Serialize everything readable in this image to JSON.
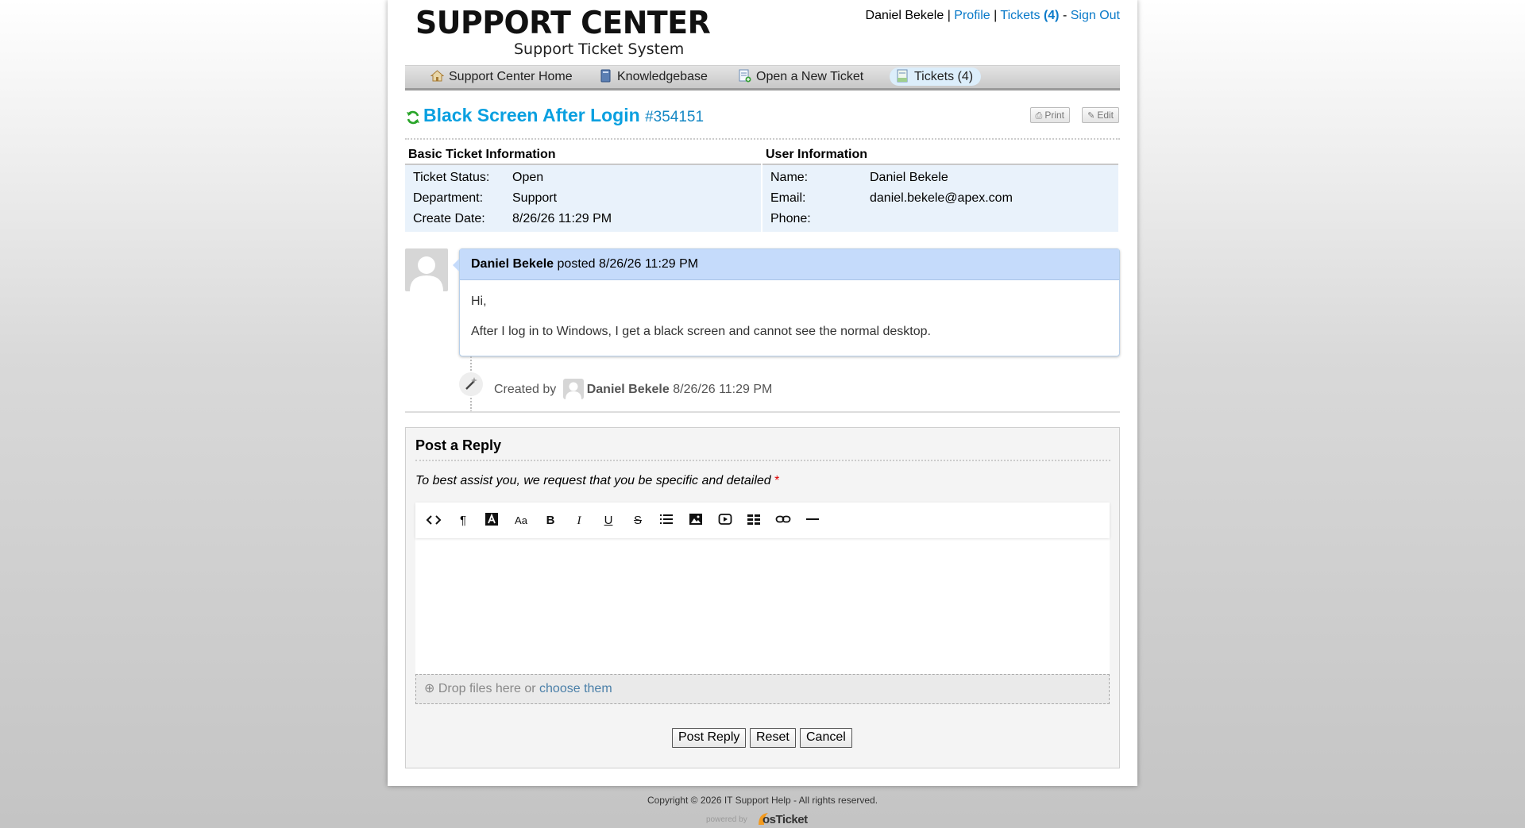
{
  "header": {
    "logo_main": "SUPPORT CENTER",
    "logo_sub": "Support Ticket System",
    "user_name": "Daniel Bekele",
    "profile_link": "Profile",
    "tickets_link": "Tickets",
    "tickets_count": "(4)",
    "signout_link": "Sign Out"
  },
  "nav": {
    "items": [
      {
        "label": "Support Center Home",
        "icon": "home-icon"
      },
      {
        "label": "Knowledgebase",
        "icon": "book-icon"
      },
      {
        "label": "Open a New Ticket",
        "icon": "new-ticket-icon"
      },
      {
        "label": "Tickets (4)",
        "icon": "tickets-icon"
      }
    ]
  },
  "ticket": {
    "title": "Black Screen After Login",
    "number": "#354151",
    "print_label": "Print",
    "edit_label": "Edit"
  },
  "basic_info": {
    "heading": "Basic Ticket Information",
    "rows": [
      {
        "label": "Ticket Status:",
        "value": "Open"
      },
      {
        "label": "Department:",
        "value": "Support"
      },
      {
        "label": "Create Date:",
        "value": "8/26/26 11:29 PM"
      }
    ]
  },
  "user_info": {
    "heading": "User Information",
    "rows": [
      {
        "label": "Name:",
        "value": "Daniel Bekele"
      },
      {
        "label": "Email:",
        "value": "daniel.bekele@apex.com"
      },
      {
        "label": "Phone:",
        "value": ""
      }
    ]
  },
  "thread": {
    "author": "Daniel Bekele",
    "posted_text": "posted 8/26/26 11:29 PM",
    "body": [
      "Hi,",
      "After I log in to Windows, I get a black screen and cannot see the normal desktop."
    ],
    "event_prefix": "Created by",
    "event_user": "Daniel Bekele",
    "event_time": "8/26/26 11:29 PM"
  },
  "reply": {
    "heading": "Post a Reply",
    "instructions": "To best assist you, we request that you be specific and detailed",
    "required_mark": "*",
    "toolbar": [
      "code-view-icon",
      "paragraph-icon",
      "text-color-icon",
      "font-size-icon",
      "bold-icon",
      "italic-icon",
      "underline-icon",
      "strikethrough-icon",
      "list-icon",
      "image-icon",
      "video-icon",
      "table-icon",
      "link-icon",
      "horizontal-rule-icon"
    ],
    "drop_text": "Drop files here or",
    "drop_link": "choose them",
    "post_button": "Post Reply",
    "reset_button": "Reset",
    "cancel_button": "Cancel"
  },
  "footer": {
    "copyright": "Copyright © 2026 IT Support Help - All rights reserved.",
    "powered_by": "powered by",
    "brand": "osTicket"
  }
}
